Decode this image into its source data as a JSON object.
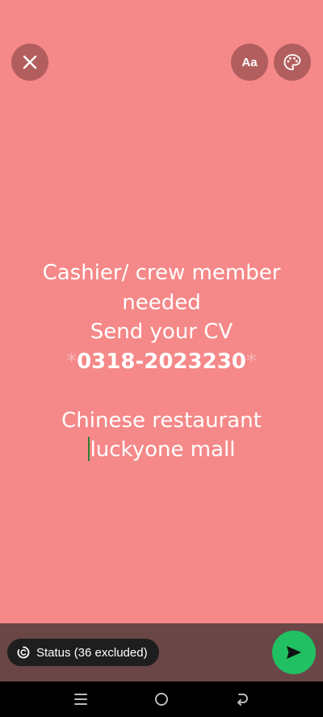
{
  "toolbar": {
    "close_icon": "close-icon",
    "font_label": "Aa",
    "palette_icon": "palette-icon"
  },
  "status": {
    "lines": [
      "Cashier/ crew member",
      "needed",
      "Send your CV"
    ],
    "phone_star_left": "*",
    "phone": "0318-2023230",
    "phone_star_right": "*",
    "blank": "",
    "line_restaurant": "Chinese restaurant",
    "line_mall": "luckyone mall"
  },
  "footer": {
    "audience_label": "Status (36 excluded)",
    "send_icon": "send-icon"
  },
  "system_nav": {
    "menu_icon": "recent-apps-icon",
    "home_icon": "home-icon",
    "back_icon": "back-icon"
  },
  "colors": {
    "background": "#f58888",
    "bottom_bar": "#6a4646",
    "send_button": "#21c063",
    "cursor": "#2e7d32"
  }
}
